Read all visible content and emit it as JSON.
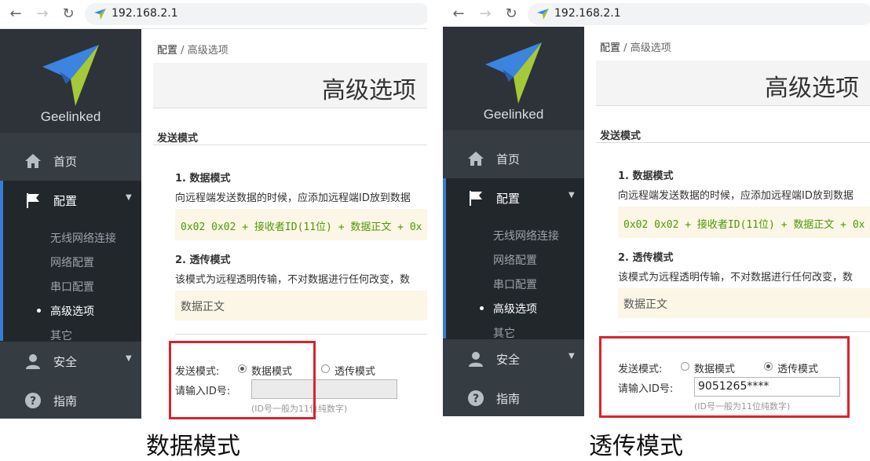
{
  "url": "192.168.2.1",
  "brand": "Geelinked",
  "nav": {
    "home": "首页",
    "config": "配置",
    "security": "安全",
    "guide": "指南"
  },
  "submenu": [
    "无线网络连接",
    "网络配置",
    "串口配置",
    "高级选项",
    "其它"
  ],
  "breadcrumb": {
    "parent": "配置",
    "sep": "/",
    "current": "高级选项"
  },
  "page_title": "高级选项",
  "section_title": "发送模式",
  "mode1": {
    "heading": "1. 数据模式",
    "desc": "向远程端发送数据的时候，应添加远程端ID放到数据",
    "code": "0x02 0x02 + 接收者ID(11位) + 数据正文 + 0x"
  },
  "mode2": {
    "heading": "2. 透传模式",
    "desc": "该模式为远程透明传输，不对数据进行任何改变，数",
    "body": "数据正文"
  },
  "form": {
    "mode_label": "发送模式:",
    "option_data": "数据模式",
    "option_transparent": "透传模式",
    "id_label": "请输入ID号:",
    "id_hint": "(ID号一般为11位纯数字)"
  },
  "panel_left": {
    "id_value": "",
    "selected": "数据模式",
    "caption": "数据模式"
  },
  "panel_right": {
    "id_value": "9051265****",
    "selected": "透传模式",
    "caption": "透传模式"
  },
  "colors": {
    "sidebar": "#2d3339",
    "active_bar": "#3a7bd5",
    "highlight_box": "#d9232e",
    "code_bg": "#fcf6e6"
  }
}
